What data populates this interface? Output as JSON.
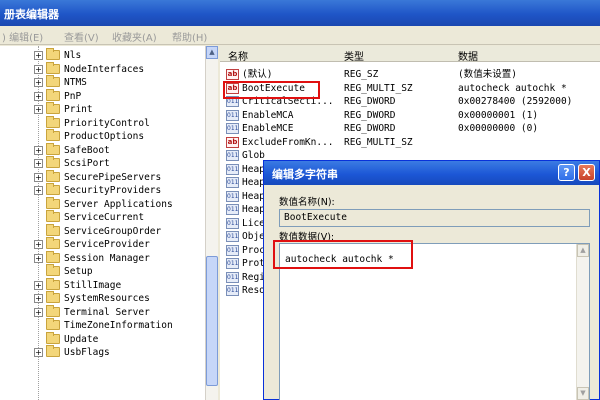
{
  "window": {
    "title": "册表编辑器"
  },
  "menu": [
    ") 编辑(E)",
    "查看(V)",
    "收藏夹(A)",
    "帮助(H)"
  ],
  "tree": {
    "items": [
      {
        "label": "Nls",
        "expander": "+"
      },
      {
        "label": "NodeInterfaces",
        "expander": "+"
      },
      {
        "label": "NTMS",
        "expander": "+"
      },
      {
        "label": "PnP",
        "expander": "+"
      },
      {
        "label": "Print",
        "expander": "+"
      },
      {
        "label": "PriorityControl",
        "expander": ""
      },
      {
        "label": "ProductOptions",
        "expander": ""
      },
      {
        "label": "SafeBoot",
        "expander": "+"
      },
      {
        "label": "ScsiPort",
        "expander": "+"
      },
      {
        "label": "SecurePipeServers",
        "expander": "+"
      },
      {
        "label": "SecurityProviders",
        "expander": "+"
      },
      {
        "label": "Server Applications",
        "expander": ""
      },
      {
        "label": "ServiceCurrent",
        "expander": ""
      },
      {
        "label": "ServiceGroupOrder",
        "expander": ""
      },
      {
        "label": "ServiceProvider",
        "expander": "+"
      },
      {
        "label": "Session Manager",
        "expander": "+"
      },
      {
        "label": "Setup",
        "expander": ""
      },
      {
        "label": "StillImage",
        "expander": "+"
      },
      {
        "label": "SystemResources",
        "expander": "+"
      },
      {
        "label": "Terminal Server",
        "expander": "+"
      },
      {
        "label": "TimeZoneInformation",
        "expander": ""
      },
      {
        "label": "Update",
        "expander": ""
      },
      {
        "label": "UsbFlags",
        "expander": "+"
      }
    ]
  },
  "list": {
    "headers": {
      "name": "名称",
      "type": "类型",
      "data": "数据"
    },
    "rows": [
      {
        "icon": "ab",
        "name": "(默认)",
        "type": "REG_SZ",
        "data": "(数值未设置)"
      },
      {
        "icon": "ab",
        "name": "BootExecute",
        "type": "REG_MULTI_SZ",
        "data": "autocheck autochk *"
      },
      {
        "icon": "bin",
        "name": "CriticalSecti...",
        "type": "REG_DWORD",
        "data": "0x00278400 (2592000)"
      },
      {
        "icon": "bin",
        "name": "EnableMCA",
        "type": "REG_DWORD",
        "data": "0x00000001 (1)"
      },
      {
        "icon": "bin",
        "name": "EnableMCE",
        "type": "REG_DWORD",
        "data": "0x00000000 (0)"
      },
      {
        "icon": "ab",
        "name": "ExcludeFromKn...",
        "type": "REG_MULTI_SZ",
        "data": ""
      },
      {
        "icon": "bin",
        "name": "Glob",
        "type": "",
        "data": ""
      },
      {
        "icon": "bin",
        "name": "Heap",
        "type": "",
        "data": ""
      },
      {
        "icon": "bin",
        "name": "Heap",
        "type": "",
        "data": ""
      },
      {
        "icon": "bin",
        "name": "Heap",
        "type": "",
        "data": ""
      },
      {
        "icon": "bin",
        "name": "Heap",
        "type": "",
        "data": ""
      },
      {
        "icon": "bin",
        "name": "Lice",
        "type": "",
        "data": ""
      },
      {
        "icon": "bin",
        "name": "Obje",
        "type": "",
        "data": ""
      },
      {
        "icon": "bin",
        "name": "Proc",
        "type": "",
        "data": ""
      },
      {
        "icon": "bin",
        "name": "Prot",
        "type": "",
        "data": ""
      },
      {
        "icon": "bin",
        "name": "Regi",
        "type": "",
        "data": ""
      },
      {
        "icon": "bin",
        "name": "Reso",
        "type": "",
        "data": ""
      }
    ]
  },
  "dialog": {
    "title": "编辑多字符串",
    "help_label": "?",
    "close_label": "X",
    "name_label": "数值名称(N):",
    "name_value": "BootExecute",
    "data_label": "数值数据(V):",
    "data_value": "autocheck autochk *"
  }
}
